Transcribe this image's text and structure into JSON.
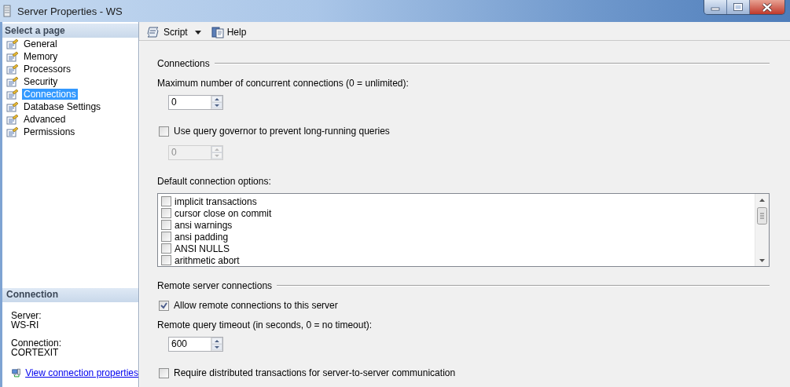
{
  "window": {
    "title": "Server Properties - WS"
  },
  "sidebar": {
    "header": "Select a page",
    "items": [
      {
        "label": "General",
        "selected": false
      },
      {
        "label": "Memory",
        "selected": false
      },
      {
        "label": "Processors",
        "selected": false
      },
      {
        "label": "Security",
        "selected": false
      },
      {
        "label": "Connections",
        "selected": true
      },
      {
        "label": "Database Settings",
        "selected": false
      },
      {
        "label": "Advanced",
        "selected": false
      },
      {
        "label": "Permissions",
        "selected": false
      }
    ]
  },
  "connection": {
    "header": "Connection",
    "fields": [
      {
        "label": "Server:",
        "value": "WS-RI"
      },
      {
        "label": "Connection:",
        "value": "CORTEXIT"
      }
    ],
    "link": "View connection properties"
  },
  "toolbar": {
    "buttons": [
      {
        "label": "Script",
        "kind": "script"
      },
      {
        "label": "Help",
        "kind": "help"
      }
    ]
  },
  "form": [
    {
      "kind": "group",
      "label": "Connections"
    },
    {
      "kind": "label",
      "label": "Maximum number of concurrent connections (0 = unlimited):"
    },
    {
      "kind": "spin",
      "value": "0",
      "disabled": false
    },
    {
      "kind": "check",
      "label": "Use query governor to prevent long-running queries",
      "checked": false
    },
    {
      "kind": "spin",
      "value": "0",
      "disabled": true
    },
    {
      "kind": "label",
      "label": "Default connection options:"
    },
    {
      "kind": "list",
      "options": [
        {
          "label": "implicit transactions",
          "checked": false
        },
        {
          "label": "cursor close on commit",
          "checked": false
        },
        {
          "label": "ansi warnings",
          "checked": false
        },
        {
          "label": "ansi padding",
          "checked": false
        },
        {
          "label": "ANSI NULLS",
          "checked": false
        },
        {
          "label": "arithmetic abort",
          "checked": false
        }
      ]
    },
    {
      "kind": "group",
      "label": "Remote server connections"
    },
    {
      "kind": "check",
      "label": "Allow remote connections to this server",
      "checked": true
    },
    {
      "kind": "label",
      "label": "Remote query timeout (in seconds, 0 = no timeout):"
    },
    {
      "kind": "spin",
      "value": "600",
      "disabled": false
    },
    {
      "kind": "check",
      "label": "Require distributed transactions for server-to-server communication",
      "checked": false
    }
  ]
}
